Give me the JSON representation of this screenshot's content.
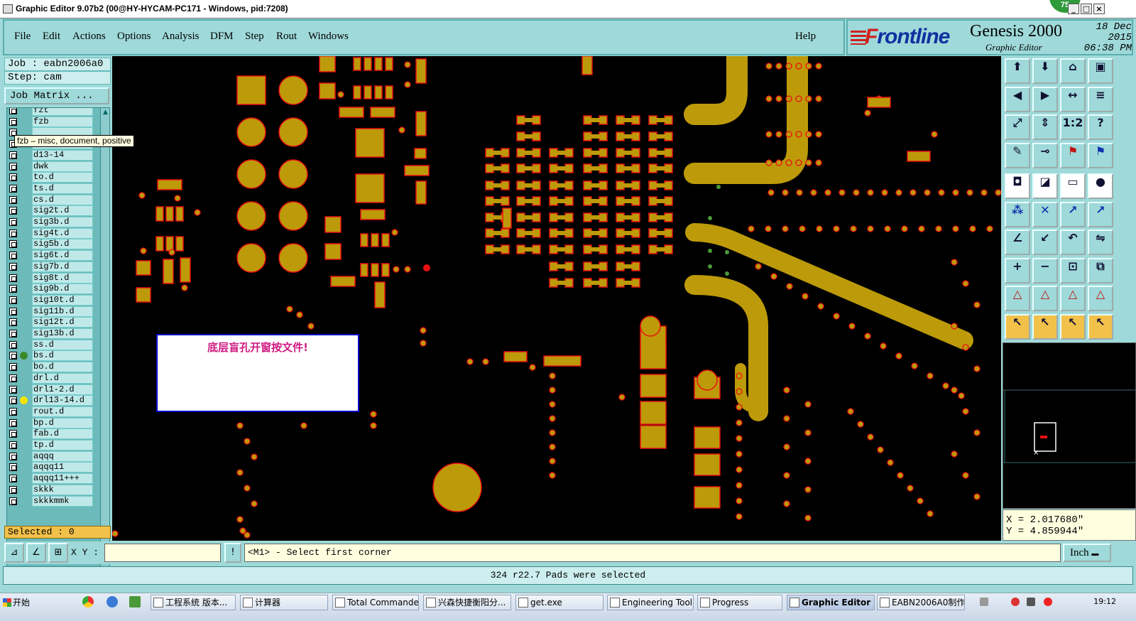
{
  "window": {
    "title": "Graphic Editor 9.07b2 (00@HY-HYCAM-PC171 - Windows, pid:7208)",
    "notification_count": "75"
  },
  "menu": {
    "items": [
      "File",
      "Edit",
      "Actions",
      "Options",
      "Analysis",
      "DFM",
      "Step",
      "Rout",
      "Windows"
    ],
    "help": "Help"
  },
  "brand": {
    "logo_F": "F",
    "logo_rest": "rontline",
    "product": "Genesis 2000",
    "subtitle": "Graphic Editor",
    "date": "18 Dec 2015",
    "time": "06:38 PM"
  },
  "job": {
    "job_line": "Job : eabn2006a0",
    "step_line": "Step: cam",
    "matrix_button": "Job Matrix ..."
  },
  "layers": [
    {
      "name": "fzt"
    },
    {
      "name": "fzb"
    },
    {
      "name": ""
    },
    {
      "name": "dl-2"
    },
    {
      "name": "d13-14"
    },
    {
      "name": "dwk"
    },
    {
      "name": "to.d",
      "edit": true
    },
    {
      "name": "ts.d"
    },
    {
      "name": "cs.d"
    },
    {
      "name": "sig2t.d"
    },
    {
      "name": "sig3b.d"
    },
    {
      "name": "sig4t.d"
    },
    {
      "name": "sig5b.d"
    },
    {
      "name": "sig6t.d"
    },
    {
      "name": "sig7b.d"
    },
    {
      "name": "sig8t.d"
    },
    {
      "name": "sig9b.d"
    },
    {
      "name": "sig10t.d"
    },
    {
      "name": "sig11b.d"
    },
    {
      "name": "sig12t.d"
    },
    {
      "name": "sig13b.d"
    },
    {
      "name": "ss.d"
    },
    {
      "name": "bs.d",
      "color": "#3a8a2a"
    },
    {
      "name": "bo.d",
      "edit": true
    },
    {
      "name": "drl.d"
    },
    {
      "name": "drl1-2.d"
    },
    {
      "name": "drl13-14.d",
      "color": "#f4e400"
    },
    {
      "name": "rout.d"
    },
    {
      "name": "bp.d"
    },
    {
      "name": "fab.d"
    },
    {
      "name": "tp.d"
    },
    {
      "name": "aqqq"
    },
    {
      "name": "aqqq11"
    },
    {
      "name": "aqqq11+++"
    },
    {
      "name": "skkk"
    },
    {
      "name": "skkkmmk"
    }
  ],
  "tooltip": "fzb – misc, document, positive",
  "selected": "Selected : 0",
  "canvas": {
    "note_text": "底层盲孔开窗按文件!",
    "pad_color": "#bd9a0a",
    "outline_color": "#e81010",
    "background": "#000000"
  },
  "toolbox": {
    "icons": [
      "open-step-icon",
      "save-icon",
      "home-icon",
      "window-icon",
      "prev-icon",
      "next-icon",
      "swap-icon",
      "step-icon",
      "fit-icon",
      "zoom-fit-icon",
      "one-to-one-icon",
      "help-icon",
      "measure-icon",
      "snap-icon",
      "layer-red-icon",
      "layer-blue-icon",
      "feature-icon",
      "rotate-icon",
      "ruler-icon",
      "dot-icon",
      "connect-icon",
      "delete-icon",
      "move-icon",
      "copy-icon",
      "line-icon",
      "arrow-icon",
      "undo-icon",
      "mirror-icon",
      "add-icon",
      "cut-icon",
      "scale-icon",
      "group-icon",
      "triangle-1-icon",
      "triangle-2-icon",
      "triangle-3-icon",
      "triangle-4-icon",
      "pointer-1-icon",
      "pointer-2-icon",
      "pointer-3-icon",
      "pointer-4-icon"
    ],
    "one_to_one_label": "1:2",
    "help_label": "?"
  },
  "coords": {
    "x": "X = 2.017680\"",
    "y": "Y = 4.859944\""
  },
  "command": {
    "xy_label": "X Y :",
    "xy_value": "",
    "warn_label": "!",
    "prompt": "<M1> - Select first corner",
    "units": "Inch"
  },
  "status": "324 r22.7 Pads were selected",
  "taskbar": {
    "start": "开始",
    "tasks": [
      "工程系统  版本...",
      "计算器",
      "Total Commander ...",
      "兴森快捷衡阳分...",
      "get.exe",
      "Engineering Toolki...",
      "Progress",
      "Graphic Editor 9....",
      "EABN2006A0制作..."
    ],
    "active_task": "Graphic Editor 9....",
    "clock": "19:12"
  }
}
